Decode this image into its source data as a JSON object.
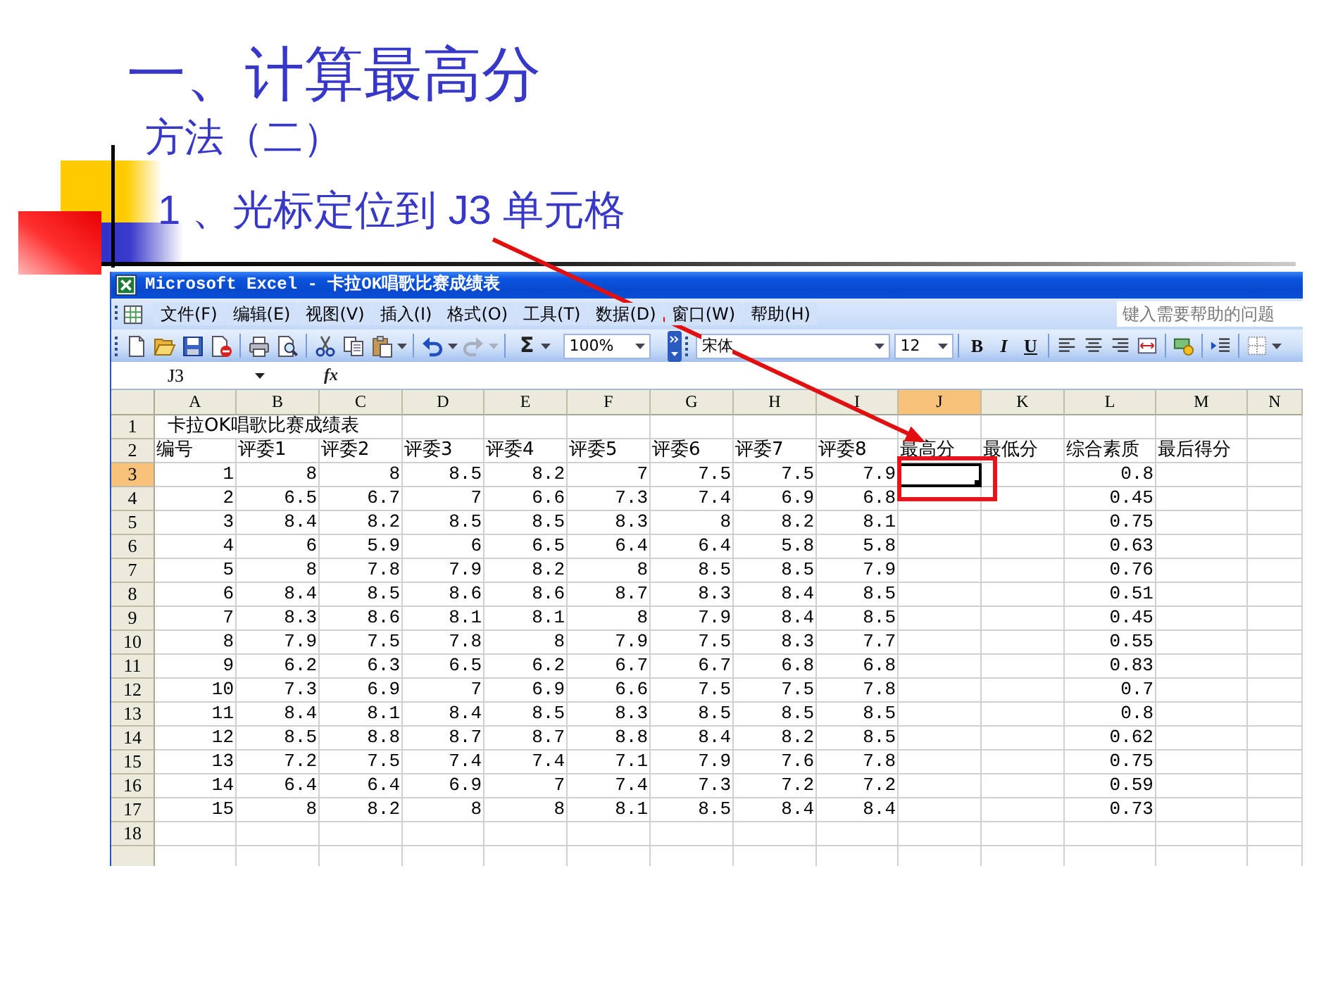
{
  "slide": {
    "title": "一、计算最高分",
    "subtitle": "方法（二）",
    "step": "1 、光标定位到 J3 单元格"
  },
  "excel": {
    "title": "Microsoft Excel - 卡拉OK唱歌比赛成绩表",
    "menu": [
      "文件(F)",
      "编辑(E)",
      "视图(V)",
      "插入(I)",
      "格式(O)",
      "工具(T)",
      "数据(D)",
      "窗口(W)",
      "帮助(H)"
    ],
    "help_placeholder": "键入需要帮助的问题",
    "toolbar": {
      "undo": {
        "disabled": false
      },
      "redo": {
        "disabled": true
      },
      "sum": "Σ",
      "zoom": "100%",
      "font": "宋体",
      "font_size": "12",
      "format_buttons": [
        {
          "label": "B",
          "kind": "bold"
        },
        {
          "label": "I",
          "kind": "italic"
        },
        {
          "label": "U",
          "kind": "underline"
        }
      ]
    },
    "name_box": "J3",
    "function_label": "fx",
    "columns": [
      {
        "label": "A",
        "selected": false
      },
      {
        "label": "B",
        "selected": false
      },
      {
        "label": "C",
        "selected": false
      },
      {
        "label": "D",
        "selected": false
      },
      {
        "label": "E",
        "selected": false
      },
      {
        "label": "F",
        "selected": false
      },
      {
        "label": "G",
        "selected": false
      },
      {
        "label": "H",
        "selected": false
      },
      {
        "label": "I",
        "selected": false
      },
      {
        "label": "J",
        "selected": true
      },
      {
        "label": "K",
        "selected": false
      },
      {
        "label": "L",
        "selected": false
      },
      {
        "label": "M",
        "selected": false
      },
      {
        "label": "N",
        "selected": false
      }
    ],
    "rows": [
      {
        "number": "1",
        "kind": "title",
        "selected": false,
        "cells": [
          "卡拉OK唱歌比赛成绩表"
        ]
      },
      {
        "number": "2",
        "kind": "header",
        "selected": false,
        "cells": [
          "编号",
          "评委1",
          "评委2",
          "评委3",
          "评委4",
          "评委5",
          "评委6",
          "评委7",
          "评委8",
          "最高分",
          "最低分",
          "综合素质",
          "最后得分"
        ]
      },
      {
        "number": "3",
        "kind": "data",
        "selected": true,
        "cells": [
          "1",
          "8",
          "8",
          "8.5",
          "8.2",
          "7",
          "7.5",
          "7.5",
          "7.9",
          null,
          null,
          "0.8"
        ]
      },
      {
        "number": "4",
        "kind": "data",
        "selected": false,
        "cells": [
          "2",
          "6.5",
          "6.7",
          "7",
          "6.6",
          "7.3",
          "7.4",
          "6.9",
          "6.8",
          null,
          null,
          "0.45"
        ]
      },
      {
        "number": "5",
        "kind": "data",
        "selected": false,
        "cells": [
          "3",
          "8.4",
          "8.2",
          "8.5",
          "8.5",
          "8.3",
          "8",
          "8.2",
          "8.1",
          null,
          null,
          "0.75"
        ]
      },
      {
        "number": "6",
        "kind": "data",
        "selected": false,
        "cells": [
          "4",
          "6",
          "5.9",
          "6",
          "6.5",
          "6.4",
          "6.4",
          "5.8",
          "5.8",
          null,
          null,
          "0.63"
        ]
      },
      {
        "number": "7",
        "kind": "data",
        "selected": false,
        "cells": [
          "5",
          "8",
          "7.8",
          "7.9",
          "8.2",
          "8",
          "8.5",
          "8.5",
          "7.9",
          null,
          null,
          "0.76"
        ]
      },
      {
        "number": "8",
        "kind": "data",
        "selected": false,
        "cells": [
          "6",
          "8.4",
          "8.5",
          "8.6",
          "8.6",
          "8.7",
          "8.3",
          "8.4",
          "8.5",
          null,
          null,
          "0.51"
        ]
      },
      {
        "number": "9",
        "kind": "data",
        "selected": false,
        "cells": [
          "7",
          "8.3",
          "8.6",
          "8.1",
          "8.1",
          "8",
          "7.9",
          "8.4",
          "8.5",
          null,
          null,
          "0.45"
        ]
      },
      {
        "number": "10",
        "kind": "data",
        "selected": false,
        "cells": [
          "8",
          "7.9",
          "7.5",
          "7.8",
          "8",
          "7.9",
          "7.5",
          "8.3",
          "7.7",
          null,
          null,
          "0.55"
        ]
      },
      {
        "number": "11",
        "kind": "data",
        "selected": false,
        "cells": [
          "9",
          "6.2",
          "6.3",
          "6.5",
          "6.2",
          "6.7",
          "6.7",
          "6.8",
          "6.8",
          null,
          null,
          "0.83"
        ]
      },
      {
        "number": "12",
        "kind": "data",
        "selected": false,
        "cells": [
          "10",
          "7.3",
          "6.9",
          "7",
          "6.9",
          "6.6",
          "7.5",
          "7.5",
          "7.8",
          null,
          null,
          "0.7"
        ]
      },
      {
        "number": "13",
        "kind": "data",
        "selected": false,
        "cells": [
          "11",
          "8.4",
          "8.1",
          "8.4",
          "8.5",
          "8.3",
          "8.5",
          "8.5",
          "8.5",
          null,
          null,
          "0.8"
        ]
      },
      {
        "number": "14",
        "kind": "data",
        "selected": false,
        "cells": [
          "12",
          "8.5",
          "8.8",
          "8.7",
          "8.7",
          "8.8",
          "8.4",
          "8.2",
          "8.5",
          null,
          null,
          "0.62"
        ]
      },
      {
        "number": "15",
        "kind": "data",
        "selected": false,
        "cells": [
          "13",
          "7.2",
          "7.5",
          "7.4",
          "7.4",
          "7.1",
          "7.9",
          "7.6",
          "7.8",
          null,
          null,
          "0.75"
        ]
      },
      {
        "number": "16",
        "kind": "data",
        "selected": false,
        "cells": [
          "14",
          "6.4",
          "6.4",
          "6.9",
          "7",
          "7.4",
          "7.3",
          "7.2",
          "7.2",
          null,
          null,
          "0.59"
        ]
      },
      {
        "number": "17",
        "kind": "data",
        "selected": false,
        "cells": [
          "15",
          "8",
          "8.2",
          "8",
          "8",
          "8.1",
          "8.5",
          "8.4",
          "8.4",
          null,
          null,
          "0.73"
        ]
      },
      {
        "number": "18",
        "selected": false
      }
    ]
  }
}
